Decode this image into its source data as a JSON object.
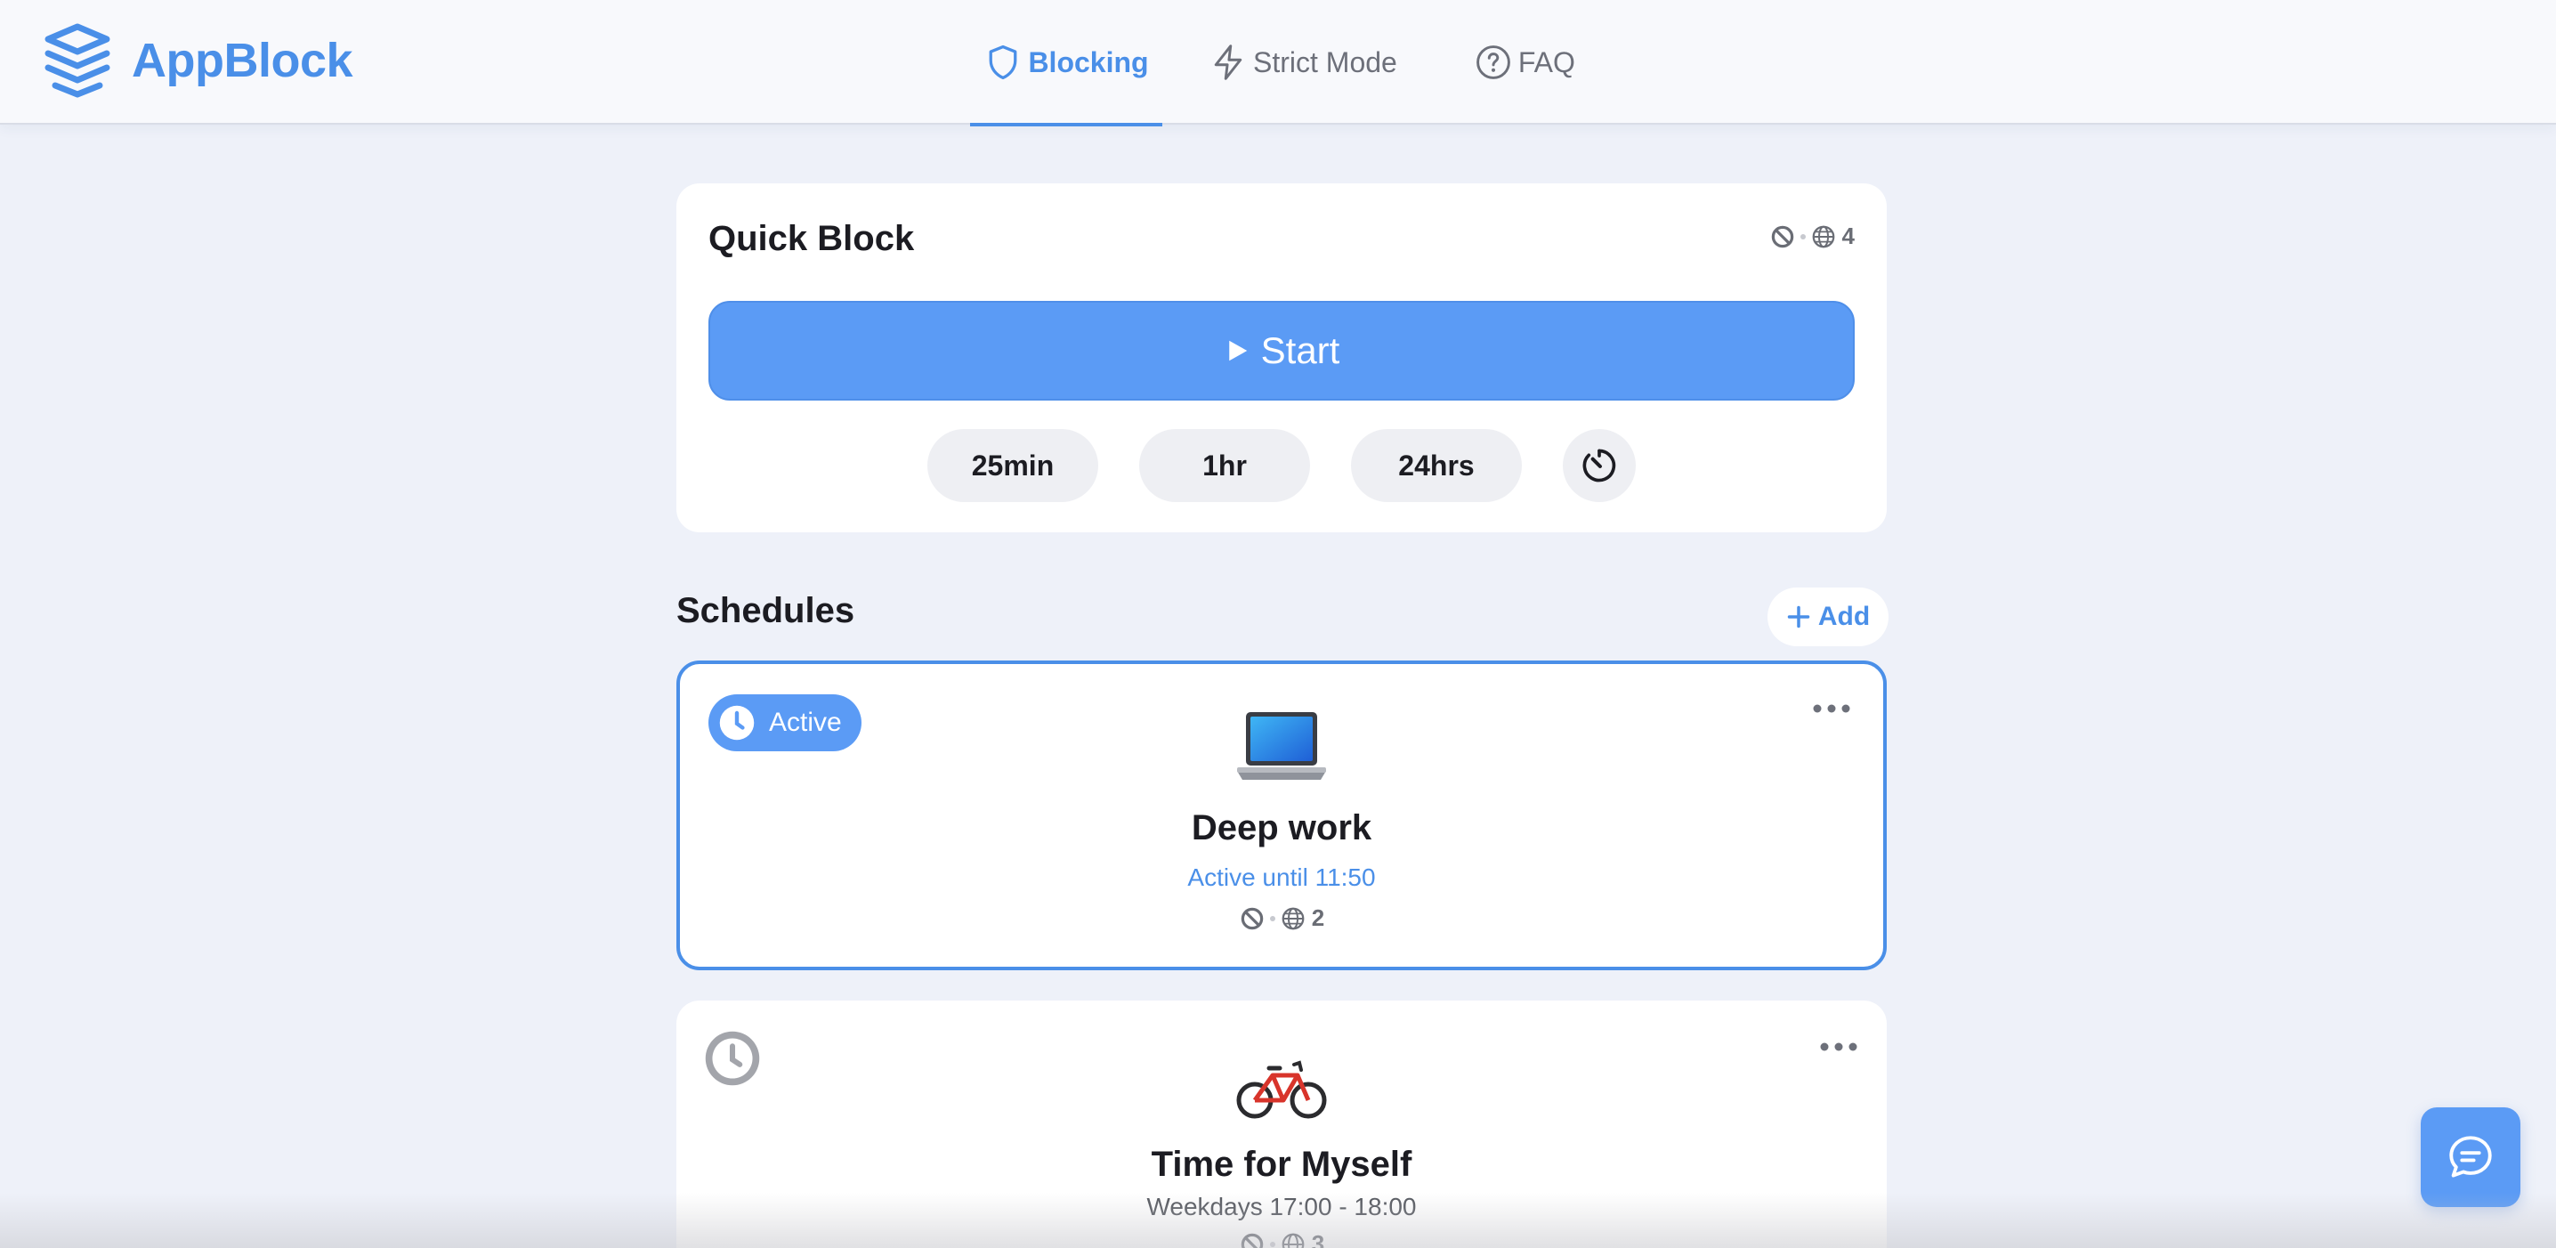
{
  "brand": {
    "name": "AppBlock",
    "color": "#4a8fe8"
  },
  "nav": {
    "items": [
      {
        "label": "Blocking",
        "icon": "shield-icon",
        "active": true
      },
      {
        "label": "Strict Mode",
        "icon": "lightning-icon",
        "active": false
      },
      {
        "label": "FAQ",
        "icon": "question-circle-icon",
        "active": false
      }
    ]
  },
  "quick_block": {
    "title": "Quick Block",
    "count": "4",
    "start_label": "Start",
    "durations": [
      "25min",
      "1hr",
      "24hrs"
    ],
    "custom_timer_icon": "timer-icon"
  },
  "schedules": {
    "title": "Schedules",
    "add_label": "Add",
    "items": [
      {
        "status": "Active",
        "icon": "laptop-icon",
        "name": "Deep work",
        "subtitle": "Active until 11:50",
        "count": "2"
      },
      {
        "status": "",
        "icon": "bicycle-icon",
        "name": "Time for Myself",
        "subtitle": "Weekdays 17:00 - 18:00",
        "count": "3"
      }
    ]
  },
  "chat": {
    "icon": "chat-icon"
  },
  "colors": {
    "accent": "#5b9bf5",
    "background": "#eef1f9",
    "card": "#ffffff"
  }
}
